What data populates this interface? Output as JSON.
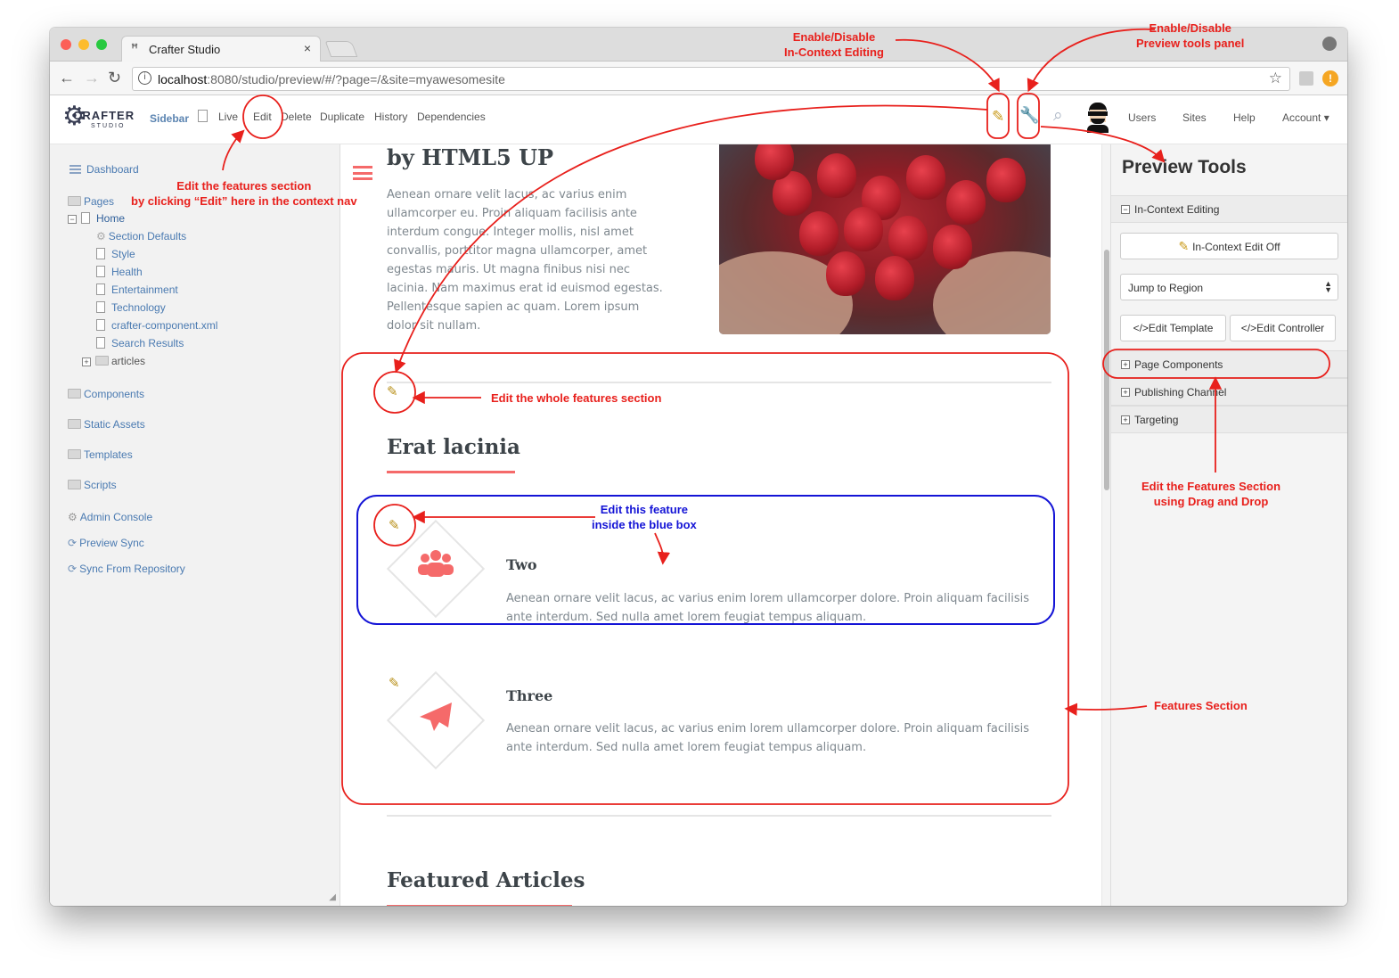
{
  "browser": {
    "tab_title": "Crafter Studio",
    "tab_close": "×",
    "url_host": "localhost",
    "url_rest": ":8080/studio/preview/#/?page=/&site=myawesomesite",
    "star": "☆"
  },
  "studio": {
    "logo_word": "CRAFTER",
    "logo_sub": "STUDIO",
    "sidebar_label": "Sidebar",
    "context_nav": [
      "Live",
      "Edit",
      "Delete",
      "Duplicate",
      "History",
      "Dependencies"
    ],
    "right_nav": [
      "Users",
      "Sites",
      "Help",
      "Account ▾"
    ]
  },
  "sidebar": {
    "dashboard": "Dashboard",
    "pages": "Pages",
    "home": "Home",
    "home_children": [
      "Section Defaults",
      "Style",
      "Health",
      "Entertainment",
      "Technology",
      "crafter-component.xml",
      "Search Results"
    ],
    "articles": "articles",
    "folders": [
      "Components",
      "Static Assets",
      "Templates",
      "Scripts"
    ],
    "tools": [
      "Admin Console",
      "Preview Sync",
      "Sync From Repository"
    ]
  },
  "preview": {
    "byline": "by HTML5 UP",
    "intro": "Aenean ornare velit lacus, ac varius enim ullamcorper eu. Proin aliquam facilisis ante interdum congue. Integer mollis, nisl amet convallis, porttitor magna ullamcorper, amet egestas mauris. Ut magna finibus nisi nec lacinia. Nam maximus erat id euismod egestas. Pellentesque sapien ac quam. Lorem ipsum dolor sit nullam.",
    "features_heading": "Erat lacinia",
    "features": [
      {
        "title": "Two",
        "icon": "users-icon",
        "text": "Aenean ornare velit lacus, ac varius enim lorem ullamcorper dolore. Proin aliquam facilisis ante interdum. Sed nulla amet lorem feugiat tempus aliquam."
      },
      {
        "title": "Three",
        "icon": "paper-plane-icon",
        "text": "Aenean ornare velit lacus, ac varius enim lorem ullamcorper dolore. Proin aliquam facilisis ante interdum. Sed nulla amet lorem feugiat tempus aliquam."
      }
    ],
    "articles_heading": "Featured Articles"
  },
  "tools_panel": {
    "title": "Preview Tools",
    "in_context_editing": "In-Context Editing",
    "in_context_button": "In-Context Edit Off",
    "jump_to_region": "Jump to Region",
    "edit_template": "</>Edit Template",
    "edit_controller": "</>Edit Controller",
    "sections": [
      "Page Components",
      "Publishing Channel",
      "Targeting"
    ]
  },
  "annotations": {
    "toggle_in_context": "Enable/Disable\nIn-Context Editing",
    "toggle_tools": "Enable/Disable\nPreview tools panel",
    "edit_via_nav": "Edit the features section\nby clicking “Edit” here in the context nav",
    "edit_whole": "Edit the whole features section",
    "edit_feature": "Edit this feature\ninside the blue box",
    "drag_drop": "Edit the Features Section\nusing Drag and Drop",
    "features_section": "Features Section"
  },
  "colors": {
    "accent": "#f56a6a",
    "annotation_red": "#e8201c",
    "annotation_blue": "#1414d6",
    "link_blue": "#4a7ab1"
  }
}
